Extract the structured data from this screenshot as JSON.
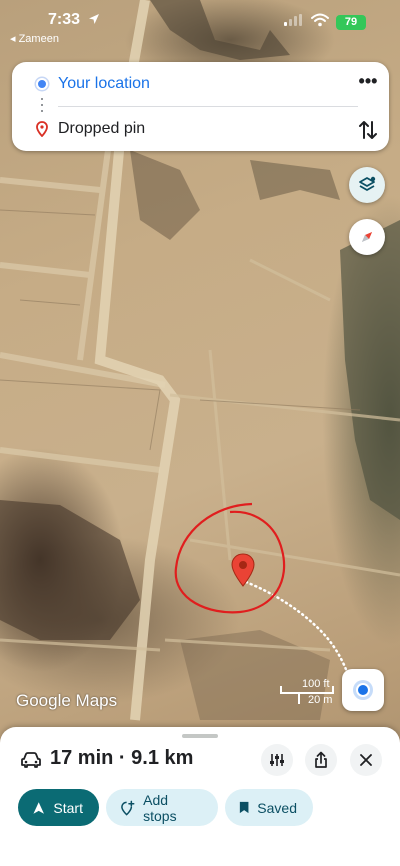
{
  "status_bar": {
    "time": "7:33",
    "back_app": "◂ Zameen",
    "battery": "79"
  },
  "route": {
    "origin": "Your location",
    "destination": "Dropped pin",
    "more_label": "•••"
  },
  "map": {
    "attribution": "Google Maps",
    "scale_imperial": "100 ft",
    "scale_metric": "20 m"
  },
  "directions": {
    "eta": "17 min · 9.1 km",
    "start_label": "Start",
    "add_stops_label": "Add stops",
    "saved_label": "Saved"
  },
  "colors": {
    "accent": "#1a73e8",
    "start_button": "#0b6b74",
    "pill": "#dcf0f6",
    "pin": "#ea4335",
    "annotation": "#e01e1e"
  },
  "icons": [
    "location-arrow-icon",
    "signal-icon",
    "wifi-icon",
    "origin-dot-icon",
    "destination-pin-icon",
    "swap-icon",
    "layers-icon",
    "compass-icon",
    "my-location-icon",
    "car-icon",
    "tune-icon",
    "share-icon",
    "close-icon",
    "navigation-arrow-icon",
    "add-stop-icon",
    "bookmark-icon"
  ]
}
